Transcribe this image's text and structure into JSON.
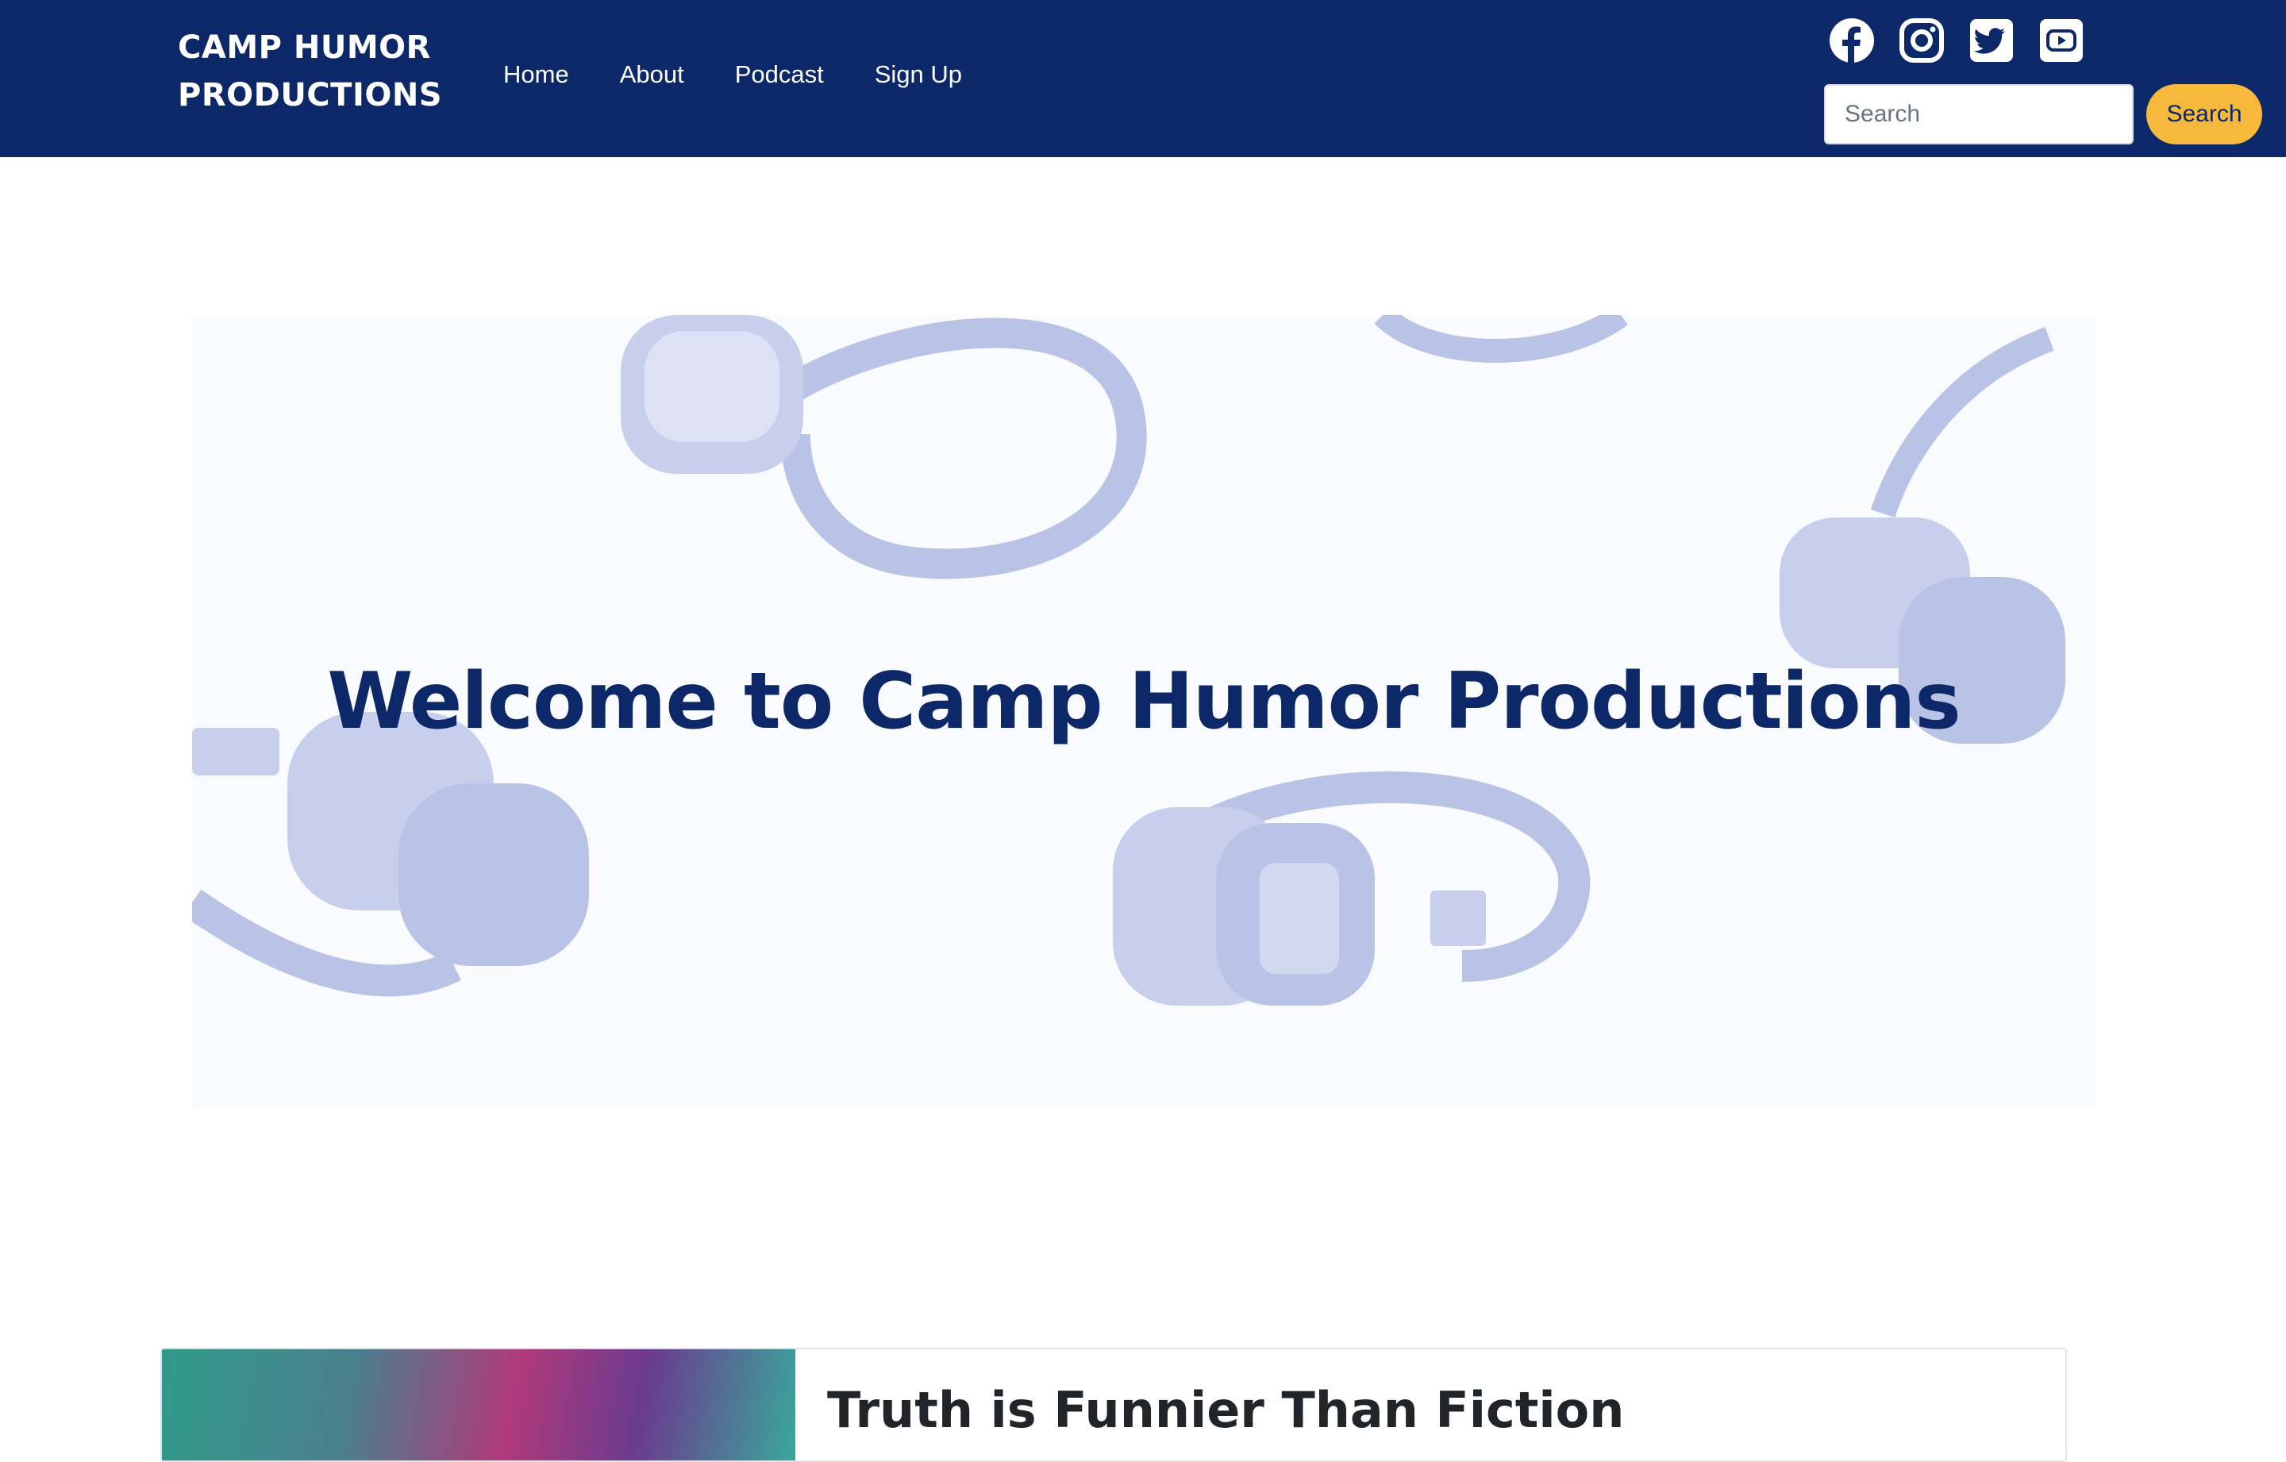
{
  "header": {
    "brand": "CAMP HUMOR PRODUCTIONS",
    "nav": [
      "Home",
      "About",
      "Podcast",
      "Sign Up"
    ],
    "socials": [
      "facebook-icon",
      "instagram-icon",
      "twitter-icon",
      "youtube-icon"
    ],
    "search_placeholder": "Search",
    "search_button": "Search"
  },
  "hero": {
    "title": "Welcome to Camp Humor Productions"
  },
  "card": {
    "title": "Truth is Funnier Than Fiction"
  },
  "colors": {
    "navbar": "#0c2869",
    "accent": "#f6b93b",
    "hero_title": "#0c2869",
    "headphones": "#b9c3e6"
  }
}
